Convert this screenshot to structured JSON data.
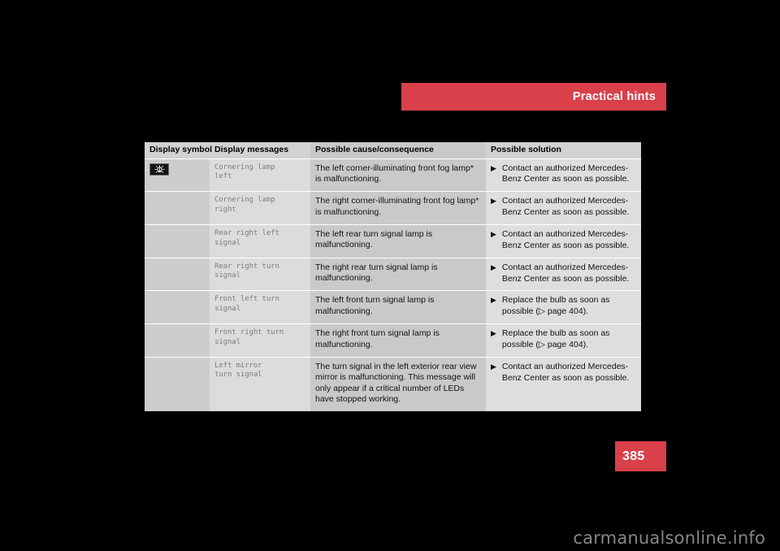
{
  "header": {
    "title": "Practical hints",
    "bar_color": "#d9404a"
  },
  "table": {
    "columns": [
      {
        "key": "symbol",
        "label": "Display symbol"
      },
      {
        "key": "message",
        "label": "Display messages"
      },
      {
        "key": "cause",
        "label": "Possible cause/consequence"
      },
      {
        "key": "solution",
        "label": "Possible solution"
      }
    ],
    "rows": [
      {
        "symbol_icon": "lamp-indicator-icon",
        "message": "Cornering lamp\nleft",
        "cause": "The left corner-illuminating front fog lamp* is malfunctioning.",
        "solution_bullet": "▶",
        "solution": "Contact an authorized Mercedes-Benz Center as soon as possible.",
        "solution_ref": ""
      },
      {
        "symbol_icon": "",
        "message": "Cornering lamp\nright",
        "cause": "The right corner-illuminating front fog lamp* is malfunctioning.",
        "solution_bullet": "▶",
        "solution": "Contact an authorized Mercedes-Benz Center as soon as possible.",
        "solution_ref": ""
      },
      {
        "symbol_icon": "",
        "message": "Rear right left signal",
        "cause": "The left rear turn signal lamp is malfunctioning.",
        "solution_bullet": "▶",
        "solution": "Contact an authorized Mercedes-Benz Center as soon as possible.",
        "solution_ref": ""
      },
      {
        "symbol_icon": "",
        "message": "Rear right turn signal",
        "cause": "The right rear turn signal lamp is malfunctioning.",
        "solution_bullet": "▶",
        "solution": "Contact an authorized Mercedes-Benz Center as soon as possible.",
        "solution_ref": ""
      },
      {
        "symbol_icon": "",
        "message": "Front left turn signal",
        "cause": "The left front turn signal lamp is malfunctioning.",
        "solution_bullet": "▶",
        "solution": "Replace the bulb as soon as possible",
        "solution_ref": "(▷ page 404)."
      },
      {
        "symbol_icon": "",
        "message": "Front right turn signal",
        "cause": "The right front turn signal lamp is malfunctioning.",
        "solution_bullet": "▶",
        "solution": "Replace the bulb as soon as possible",
        "solution_ref": "(▷ page 404)."
      },
      {
        "symbol_icon": "",
        "message": "Left mirror\nturn signal",
        "cause": "The turn signal in the left exterior rear view mirror is malfunctioning. This message will only appear if a critical number of LEDs have stopped working.",
        "solution_bullet": "▶",
        "solution": "Contact an authorized Mercedes-Benz Center as soon as possible.",
        "solution_ref": ""
      }
    ]
  },
  "page_badge": {
    "number": "385",
    "color": "#d9404a"
  },
  "watermark": {
    "text": "carmanualsonline.info"
  }
}
